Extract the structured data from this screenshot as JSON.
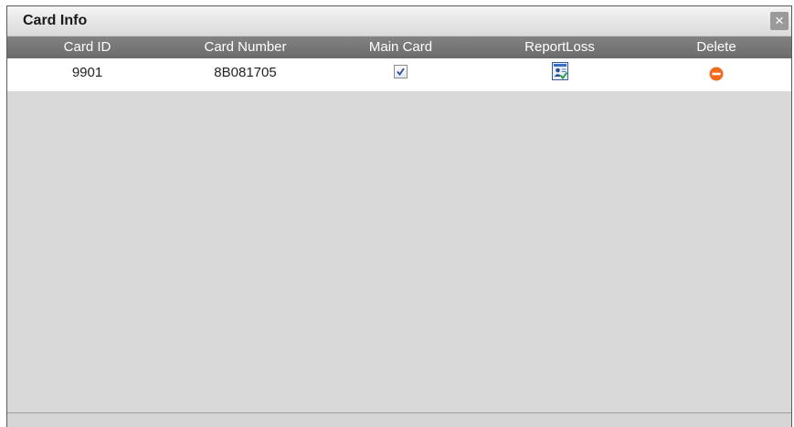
{
  "dialog": {
    "title": "Card Info",
    "close_symbol": "×"
  },
  "table": {
    "columns": [
      "Card ID",
      "Card Number",
      "Main Card",
      "ReportLoss",
      "Delete"
    ],
    "rows": [
      {
        "card_id": "9901",
        "card_number": "8B081705",
        "main_card_checked": true,
        "report_loss_icon": "report-loss-icon",
        "delete_icon": "delete-icon"
      }
    ]
  },
  "colors": {
    "header_bg": "#767676",
    "delete_orange": "#f26b1d",
    "checkbox_check": "#2f4d9b"
  }
}
